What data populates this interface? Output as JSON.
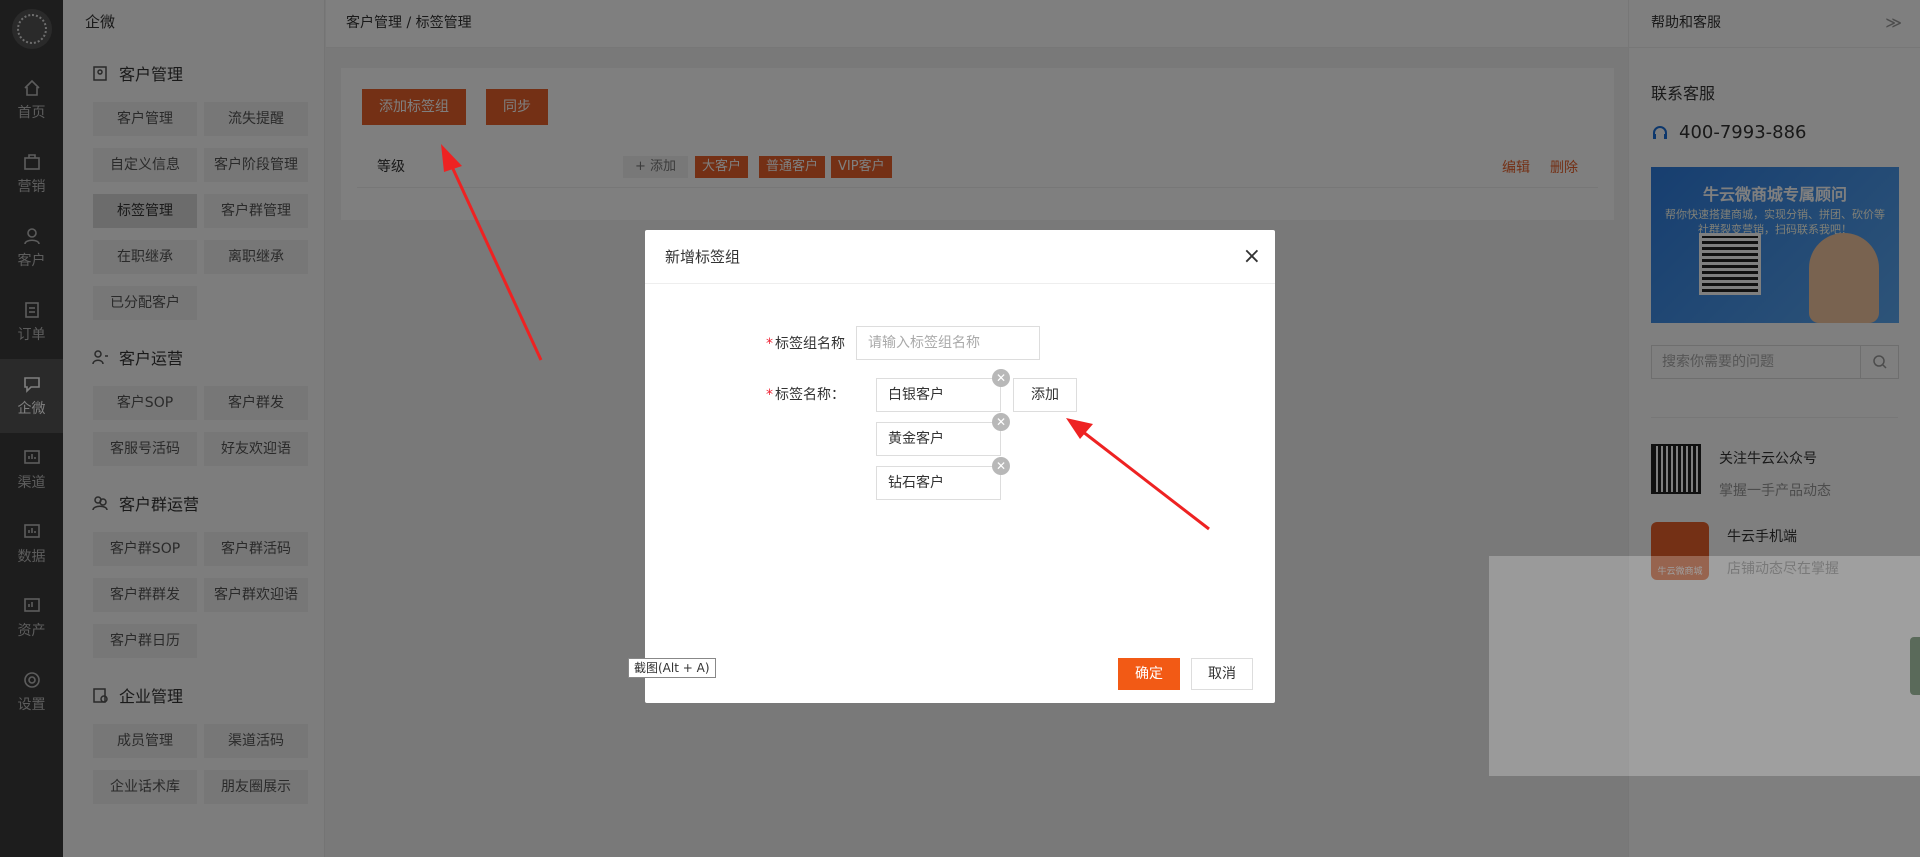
{
  "rail": [
    {
      "label": "首页",
      "icon": "home-icon"
    },
    {
      "label": "营销",
      "icon": "bag-icon"
    },
    {
      "label": "客户",
      "icon": "user-icon"
    },
    {
      "label": "订单",
      "icon": "order-icon"
    },
    {
      "label": "企微",
      "icon": "chat-icon",
      "active": true
    },
    {
      "label": "渠道",
      "icon": "channel-icon"
    },
    {
      "label": "数据",
      "icon": "data-icon"
    },
    {
      "label": "资产",
      "icon": "asset-icon"
    },
    {
      "label": "设置",
      "icon": "gear-icon"
    }
  ],
  "sidebar": {
    "title": "企微",
    "groups": [
      {
        "title": "客户管理",
        "items": [
          "客户管理",
          "流失提醒",
          "自定义信息",
          "客户阶段管理",
          "标签管理",
          "客户群管理",
          "在职继承",
          "离职继承",
          "已分配客户"
        ]
      },
      {
        "title": "客户运营",
        "items": [
          "客户SOP",
          "客户群发",
          "客服号活码",
          "好友欢迎语"
        ]
      },
      {
        "title": "客户群运营",
        "items": [
          "客户群SOP",
          "客户群活码",
          "客户群群发",
          "客户群欢迎语",
          "客户群日历"
        ]
      },
      {
        "title": "企业管理",
        "items": [
          "成员管理",
          "渠道活码",
          "企业话术库",
          "朋友圈展示"
        ]
      }
    ],
    "selected": "标签管理"
  },
  "breadcrumb": "客户管理 / 标签管理",
  "main": {
    "add_group_btn": "添加标签组",
    "sync_btn": "同步",
    "group_name": "等级",
    "add_tag": "+ 添加",
    "tags": [
      "大客户",
      "普通客户",
      "VIP客户"
    ],
    "edit": "编辑",
    "delete": "删除"
  },
  "help": {
    "header": "帮助和客服",
    "chevron": "≫",
    "contact_title": "联系客服",
    "phone": "400-7993-886",
    "banner_title": "牛云微商城专属顾问",
    "banner_sub": "帮你快速搭建商城，实现分销、拼团、砍价等社群裂变营销，扫码联系我吧！",
    "search_placeholder": "搜索你需要的问题",
    "follow_title": "关注牛云公众号",
    "follow_sub": "掌握一手产品动态",
    "app_title": "牛云手机端",
    "app_sub": "店铺动态尽在掌握",
    "app_icon_text": "牛云微商城"
  },
  "dialog": {
    "title": "新增标签组",
    "close": "×",
    "name_label": "标签组名称",
    "name_placeholder": "请输入标签组名称",
    "tag_label": "标签名称：",
    "tags": [
      "白银客户",
      "黄金客户",
      "钻石客户"
    ],
    "add": "添加",
    "ok": "确定",
    "cancel": "取消"
  },
  "tooltip": "截图(Alt + A)",
  "colors": {
    "accent": "#e8612a",
    "confirm": "#f25a15",
    "rail": "#3b3b3b",
    "arrow": "#ee2222"
  }
}
